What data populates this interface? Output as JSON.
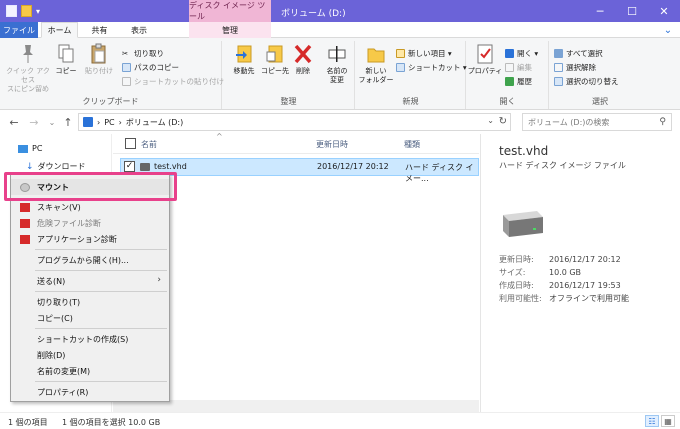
{
  "window": {
    "title": "ボリューム (D:)",
    "context_tab_group": "ディスク イメージ ツール",
    "buttons": {
      "minimize": "─",
      "maximize": "☐",
      "close": "✕"
    }
  },
  "tabs": {
    "file": "ファイル",
    "home": "ホーム",
    "share": "共有",
    "view": "表示",
    "manage": "管理"
  },
  "ribbon": {
    "clipboard": {
      "label": "クリップボード",
      "pin": "クイック アクセス\nスにピン留め",
      "copy": "コピー",
      "paste": "貼り付け",
      "cut": "切り取り",
      "copy_path": "パスのコピー",
      "paste_shortcut": "ショートカットの貼り付け"
    },
    "organize": {
      "label": "整理",
      "move_to": "移動先",
      "copy_to": "コピー先",
      "delete": "削除",
      "rename": "名前の\n変更"
    },
    "new": {
      "label": "新規",
      "new_folder": "新しい\nフォルダー",
      "new_item": "新しい項目 ▾",
      "shortcut": "ショートカット ▾"
    },
    "open": {
      "label": "開く",
      "properties": "プロパティ",
      "open": "開く ▾",
      "edit": "編集",
      "history": "履歴"
    },
    "select": {
      "label": "選択",
      "select_all": "すべて選択",
      "select_none": "選択解除",
      "invert": "選択の切り替え"
    }
  },
  "address": {
    "segments": [
      "PC",
      "ボリューム (D:)"
    ],
    "search_placeholder": "ボリューム (D:)の検索"
  },
  "nav": {
    "items": [
      "PC",
      "ダウンロード"
    ]
  },
  "columns": {
    "name": "名前",
    "modified": "更新日時",
    "type": "種類"
  },
  "files": [
    {
      "name": "test.vhd",
      "modified": "2016/12/17 20:12",
      "type": "ハード ディスク イメー..."
    }
  ],
  "preview": {
    "title": "test.vhd",
    "type": "ハード ディスク イメージ ファイル",
    "fields": [
      {
        "key": "更新日時:",
        "value": "2016/12/17 20:12"
      },
      {
        "key": "サイズ:",
        "value": "10.0 GB"
      },
      {
        "key": "作成日時:",
        "value": "2016/12/17 19:53"
      },
      {
        "key": "利用可能性:",
        "value": "オフラインで利用可能"
      }
    ]
  },
  "context_menu": {
    "mount": "マウント",
    "scan": "スキャン(V)",
    "danger_diag": "危険ファイル診断",
    "app_diag": "アプリケーション診断",
    "open_with": "プログラムから開く(H)...",
    "send_to": "送る(N)",
    "cut": "切り取り(T)",
    "copy": "コピー(C)",
    "create_shortcut": "ショートカットの作成(S)",
    "delete": "削除(D)",
    "rename": "名前の変更(M)",
    "properties": "プロパティ(R)"
  },
  "status": {
    "count": "1 個の項目",
    "selected": "1 個の項目を選択  10.0 GB"
  },
  "colors": {
    "title_bar": "#6b63d8",
    "context_tab": "#f0b6d5",
    "highlight_box": "#e8418b",
    "selection": "#cce8ff"
  }
}
